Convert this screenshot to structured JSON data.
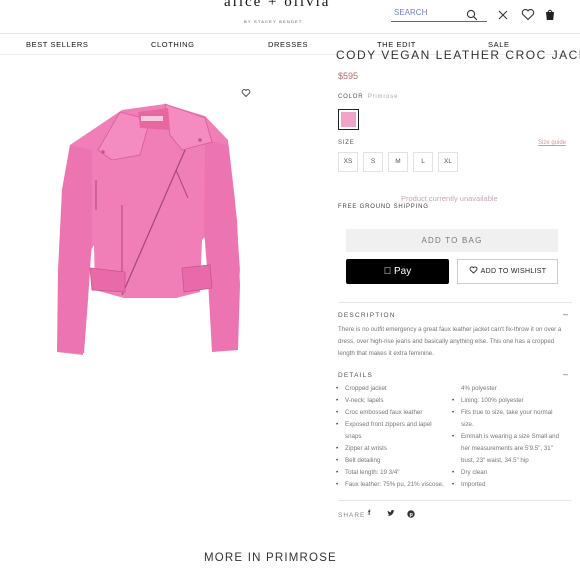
{
  "header": {
    "logo": "alice + olivia",
    "logo_sub": "BY STACEY BENDET",
    "search_placeholder": "SEARCH"
  },
  "nav": {
    "items": [
      "BEST SELLERS",
      "CLOTHING",
      "DRESSES",
      "THE EDIT",
      "SALE"
    ]
  },
  "product": {
    "title": "CODY VEGAN LEATHER CROC JACKET",
    "price": "$595",
    "color_label": "COLOR",
    "color_value": "Primrose",
    "size_label": "SIZE",
    "size_guide": "Size guide",
    "sizes": [
      "XS",
      "S",
      "M",
      "L",
      "XL"
    ],
    "unavailable": "Product currently unavailable",
    "shipping": "FREE GROUND SHIPPING",
    "add_to_bag": "ADD TO BAG",
    "apple_pay": "Pay",
    "wishlist": "ADD TO WISHLIST"
  },
  "description": {
    "heading": "DESCRIPTION",
    "toggle": "–",
    "text": "There is no outfit emergency a great faux leather jacket can't fix-throw it on over a dress, over high-rise jeans and basically anything else. This one has a cropped length that makes it extra feminine."
  },
  "details": {
    "heading": "DETAILS",
    "toggle": "–",
    "left": [
      {
        "text": "Cropped jacket",
        "bullet": true
      },
      {
        "text": "V-neck; lapels",
        "bullet": true
      },
      {
        "text": "Croc embossed faux leather",
        "bullet": true
      },
      {
        "text": "Exposed front zippers and lapel",
        "bullet": true
      },
      {
        "text": "snaps",
        "bullet": false
      },
      {
        "text": "Zipper at wrists",
        "bullet": true
      },
      {
        "text": "Belt detailing",
        "bullet": true
      },
      {
        "text": "Total length: 19 3/4\"",
        "bullet": true
      },
      {
        "text": "Faux leather: 75% pu, 21% viscose,",
        "bullet": true
      }
    ],
    "right": [
      {
        "text": "4% polyester",
        "bullet": false
      },
      {
        "text": "Lining: 100% polyester",
        "bullet": true
      },
      {
        "text": "Fits true to size, take your normal",
        "bullet": true
      },
      {
        "text": "size.",
        "bullet": false
      },
      {
        "text": "Emmah is wearing a size Small and",
        "bullet": true
      },
      {
        "text": "her measurements are 5'9.5\", 31\"",
        "bullet": false
      },
      {
        "text": "bust, 23\" waist, 34.5\" hip",
        "bullet": false
      },
      {
        "text": "Dry clean",
        "bullet": true
      },
      {
        "text": "Imported",
        "bullet": true
      }
    ]
  },
  "share": {
    "label": "SHARE",
    "icons": [
      "facebook-icon",
      "twitter-icon",
      "pinterest-icon"
    ]
  },
  "more": "MORE IN PRIMROSE",
  "colors": {
    "jacket": "#f07fb8",
    "swatch": "#f2a4c7",
    "accent": "#b86a72"
  }
}
